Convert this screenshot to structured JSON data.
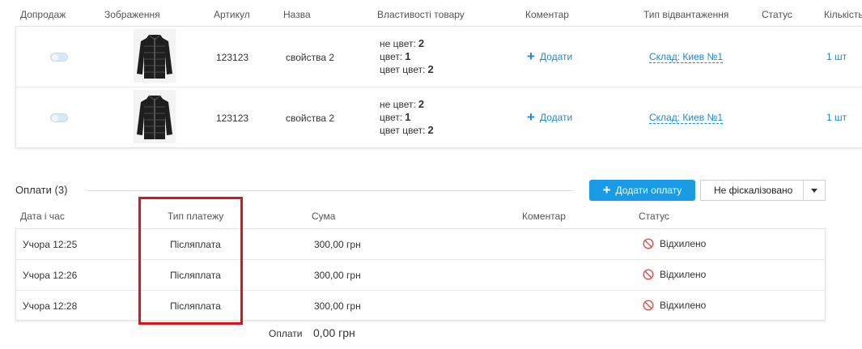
{
  "products_table": {
    "headers": {
      "upsell": "Допродаж",
      "image": "Зображення",
      "sku": "Артикул",
      "name": "Назва",
      "properties": "Властивості товару",
      "comment": "Коментар",
      "shipping_type": "Тип відвантаження",
      "status": "Статус",
      "quantity": "Кількість"
    },
    "rows": [
      {
        "sku": "123123",
        "name": "свойства 2",
        "props": [
          {
            "label": "не цвет:",
            "value": "2"
          },
          {
            "label": "цвет:",
            "value": "1"
          },
          {
            "label": "цвет цвет:",
            "value": "2"
          }
        ],
        "comment_action": "Додати",
        "shipping": "Склад: Киев №1",
        "quantity": "1 шт"
      },
      {
        "sku": "123123",
        "name": "свойства 2",
        "props": [
          {
            "label": "не цвет:",
            "value": "2"
          },
          {
            "label": "цвет:",
            "value": "1"
          },
          {
            "label": "цвет цвет:",
            "value": "2"
          }
        ],
        "comment_action": "Додати",
        "shipping": "Склад: Киев №1",
        "quantity": "1 шт"
      }
    ]
  },
  "payments": {
    "title": "Оплати (3)",
    "add_button": "Додати оплату",
    "fiscal_select": "Не фіскалізовано",
    "headers": {
      "datetime": "Дата і час",
      "type": "Тип платежу",
      "amount": "Сума",
      "comment": "Коментар",
      "status": "Статус"
    },
    "rows": [
      {
        "datetime": "Учора 12:25",
        "type": "Післяплата",
        "amount": "300,00 грн",
        "status": "Відхилено"
      },
      {
        "datetime": "Учора 12:26",
        "type": "Післяплата",
        "amount": "300,00 грн",
        "status": "Відхилено"
      },
      {
        "datetime": "Учора 12:28",
        "type": "Післяплата",
        "amount": "300,00 грн",
        "status": "Відхилено"
      }
    ],
    "total_label": "Оплати",
    "total_value": "0,00 грн"
  },
  "colors": {
    "accent": "#1a9be6",
    "link": "#1a8ad6",
    "rejected": "#d9534f",
    "highlight": "#e0121a"
  },
  "icons": {
    "add": "plus-icon",
    "rejected": "prohibited-icon",
    "dropdown": "caret-down-icon",
    "product": "jacket-image"
  }
}
